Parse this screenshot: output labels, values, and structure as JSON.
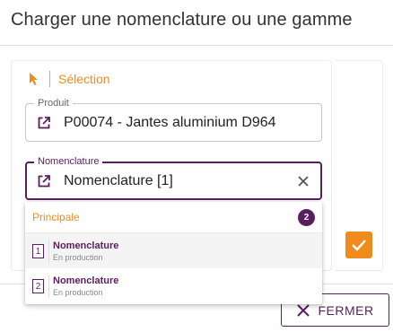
{
  "dialog": {
    "title": "Charger une nomenclature ou une gamme"
  },
  "selection": {
    "label": "Sélection",
    "icon": "cursor-pointer-icon"
  },
  "produit_field": {
    "legend": "Produit",
    "value": "P00074 - Jantes aluminium D964",
    "icon": "open-external-icon"
  },
  "nomenclature_field": {
    "legend": "Nomenclature",
    "value": "Nomenclature [1]",
    "icon": "open-external-icon",
    "clear_icon": "close-icon"
  },
  "dropdown": {
    "group_label": "Principale",
    "count": "2",
    "items": [
      {
        "num": "1",
        "name": "Nomenclature",
        "status": "En production"
      },
      {
        "num": "2",
        "name": "Nomenclature",
        "status": "En production"
      }
    ]
  },
  "footer": {
    "close_label": "FERMER"
  },
  "colors": {
    "accent": "#f08c1e",
    "primary": "#5a1e5f"
  }
}
